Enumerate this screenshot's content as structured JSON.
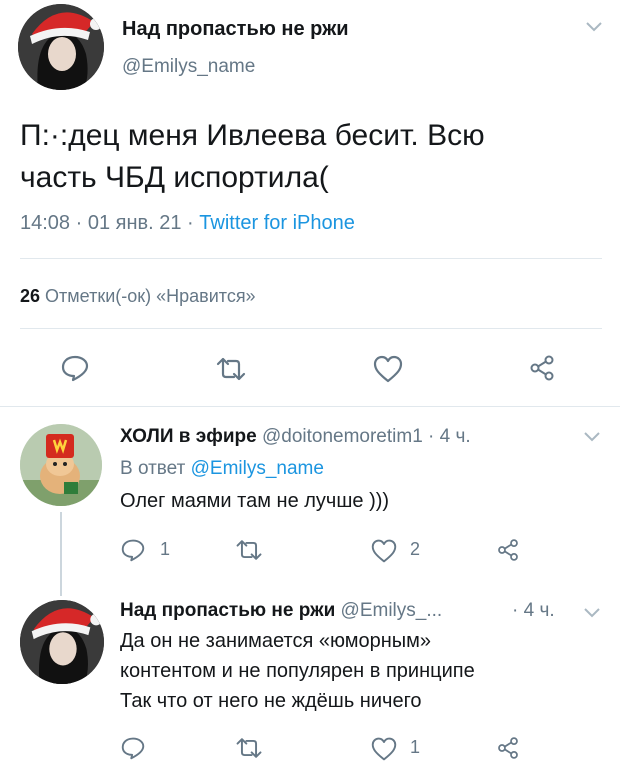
{
  "main_tweet": {
    "author_name": "Над пропастью не ржи",
    "author_handle": "@Emilys_name",
    "text_line1": "П:·:дец меня Ивлеева бесит. Всю",
    "text_line2": "часть ЧБД испортила(",
    "time": "14:08 · 01 янв. 21 · ",
    "client": "Twitter for iPhone",
    "likes_count": "26",
    "likes_label": "Отметки(-ок) «Нравится»"
  },
  "reply1": {
    "author_name": "ХОЛИ в эфире",
    "author_handle": "@doitonemoretim1 · 4 ч.",
    "reply_to_prefix": "В ответ ",
    "reply_to_handle": "@Emilys_name",
    "text": "Олег маями там не лучше )))",
    "reply_count": "1",
    "like_count": "2"
  },
  "reply2": {
    "author_name": "Над пропастью не ржи",
    "author_handle": "@Emilys_...",
    "time": "· 4 ч.",
    "text_line1": "Да он не занимается «юморным»",
    "text_line2": "контентом и не популярен в принципе",
    "text_line3": "Так что от него не ждёшь ничего",
    "like_count": "1"
  },
  "icons": {
    "reply": "reply-icon",
    "retweet": "retweet-icon",
    "like": "heart-icon",
    "share": "share-icon",
    "more": "chevron-down-icon"
  },
  "colors": {
    "link": "#1b95e0",
    "muted": "#657786",
    "divider": "#e1e8ed"
  }
}
